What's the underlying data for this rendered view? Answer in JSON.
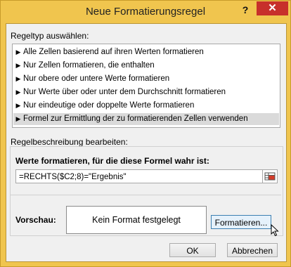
{
  "dialog": {
    "title": "Neue Formatierungsregel",
    "help_label": "?",
    "close_label": "✕"
  },
  "rule_type": {
    "label": "Regeltyp auswählen:",
    "items": [
      {
        "label": "Alle Zellen basierend auf ihren Werten formatieren",
        "selected": false
      },
      {
        "label": "Nur Zellen formatieren, die enthalten",
        "selected": false
      },
      {
        "label": "Nur obere oder untere Werte formatieren",
        "selected": false
      },
      {
        "label": "Nur Werte über oder unter dem Durchschnitt formatieren",
        "selected": false
      },
      {
        "label": "Nur eindeutige oder doppelte Werte formatieren",
        "selected": false
      },
      {
        "label": "Formel zur Ermittlung der zu formatierenden Zellen verwenden",
        "selected": true
      }
    ],
    "bullet": "▶"
  },
  "description": {
    "label": "Regelbeschreibung bearbeiten:",
    "formula_label": "Werte formatieren, für die diese Formel wahr ist:",
    "formula_value": "=RECHTS($C2;8)=\"Ergebnis\"",
    "preview_label": "Vorschau:",
    "preview_text": "Kein Format festgelegt",
    "format_button": "Formatieren..."
  },
  "footer": {
    "ok_label": "OK",
    "cancel_label": "Abbrechen"
  },
  "colors": {
    "title_bar": "#f0c54e",
    "close_button": "#c7302b",
    "selected_item": "#dadada"
  }
}
